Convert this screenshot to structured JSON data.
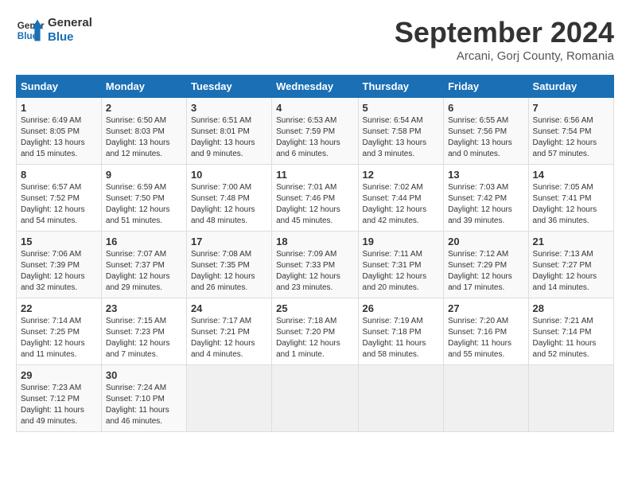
{
  "logo": {
    "line1": "General",
    "line2": "Blue"
  },
  "title": "September 2024",
  "subtitle": "Arcani, Gorj County, Romania",
  "days_of_week": [
    "Sunday",
    "Monday",
    "Tuesday",
    "Wednesday",
    "Thursday",
    "Friday",
    "Saturday"
  ],
  "weeks": [
    [
      {
        "day": 1,
        "lines": [
          "Sunrise: 6:49 AM",
          "Sunset: 8:05 PM",
          "Daylight: 13 hours",
          "and 15 minutes."
        ]
      },
      {
        "day": 2,
        "lines": [
          "Sunrise: 6:50 AM",
          "Sunset: 8:03 PM",
          "Daylight: 13 hours",
          "and 12 minutes."
        ]
      },
      {
        "day": 3,
        "lines": [
          "Sunrise: 6:51 AM",
          "Sunset: 8:01 PM",
          "Daylight: 13 hours",
          "and 9 minutes."
        ]
      },
      {
        "day": 4,
        "lines": [
          "Sunrise: 6:53 AM",
          "Sunset: 7:59 PM",
          "Daylight: 13 hours",
          "and 6 minutes."
        ]
      },
      {
        "day": 5,
        "lines": [
          "Sunrise: 6:54 AM",
          "Sunset: 7:58 PM",
          "Daylight: 13 hours",
          "and 3 minutes."
        ]
      },
      {
        "day": 6,
        "lines": [
          "Sunrise: 6:55 AM",
          "Sunset: 7:56 PM",
          "Daylight: 13 hours",
          "and 0 minutes."
        ]
      },
      {
        "day": 7,
        "lines": [
          "Sunrise: 6:56 AM",
          "Sunset: 7:54 PM",
          "Daylight: 12 hours",
          "and 57 minutes."
        ]
      }
    ],
    [
      {
        "day": 8,
        "lines": [
          "Sunrise: 6:57 AM",
          "Sunset: 7:52 PM",
          "Daylight: 12 hours",
          "and 54 minutes."
        ]
      },
      {
        "day": 9,
        "lines": [
          "Sunrise: 6:59 AM",
          "Sunset: 7:50 PM",
          "Daylight: 12 hours",
          "and 51 minutes."
        ]
      },
      {
        "day": 10,
        "lines": [
          "Sunrise: 7:00 AM",
          "Sunset: 7:48 PM",
          "Daylight: 12 hours",
          "and 48 minutes."
        ]
      },
      {
        "day": 11,
        "lines": [
          "Sunrise: 7:01 AM",
          "Sunset: 7:46 PM",
          "Daylight: 12 hours",
          "and 45 minutes."
        ]
      },
      {
        "day": 12,
        "lines": [
          "Sunrise: 7:02 AM",
          "Sunset: 7:44 PM",
          "Daylight: 12 hours",
          "and 42 minutes."
        ]
      },
      {
        "day": 13,
        "lines": [
          "Sunrise: 7:03 AM",
          "Sunset: 7:42 PM",
          "Daylight: 12 hours",
          "and 39 minutes."
        ]
      },
      {
        "day": 14,
        "lines": [
          "Sunrise: 7:05 AM",
          "Sunset: 7:41 PM",
          "Daylight: 12 hours",
          "and 36 minutes."
        ]
      }
    ],
    [
      {
        "day": 15,
        "lines": [
          "Sunrise: 7:06 AM",
          "Sunset: 7:39 PM",
          "Daylight: 12 hours",
          "and 32 minutes."
        ]
      },
      {
        "day": 16,
        "lines": [
          "Sunrise: 7:07 AM",
          "Sunset: 7:37 PM",
          "Daylight: 12 hours",
          "and 29 minutes."
        ]
      },
      {
        "day": 17,
        "lines": [
          "Sunrise: 7:08 AM",
          "Sunset: 7:35 PM",
          "Daylight: 12 hours",
          "and 26 minutes."
        ]
      },
      {
        "day": 18,
        "lines": [
          "Sunrise: 7:09 AM",
          "Sunset: 7:33 PM",
          "Daylight: 12 hours",
          "and 23 minutes."
        ]
      },
      {
        "day": 19,
        "lines": [
          "Sunrise: 7:11 AM",
          "Sunset: 7:31 PM",
          "Daylight: 12 hours",
          "and 20 minutes."
        ]
      },
      {
        "day": 20,
        "lines": [
          "Sunrise: 7:12 AM",
          "Sunset: 7:29 PM",
          "Daylight: 12 hours",
          "and 17 minutes."
        ]
      },
      {
        "day": 21,
        "lines": [
          "Sunrise: 7:13 AM",
          "Sunset: 7:27 PM",
          "Daylight: 12 hours",
          "and 14 minutes."
        ]
      }
    ],
    [
      {
        "day": 22,
        "lines": [
          "Sunrise: 7:14 AM",
          "Sunset: 7:25 PM",
          "Daylight: 12 hours",
          "and 11 minutes."
        ]
      },
      {
        "day": 23,
        "lines": [
          "Sunrise: 7:15 AM",
          "Sunset: 7:23 PM",
          "Daylight: 12 hours",
          "and 7 minutes."
        ]
      },
      {
        "day": 24,
        "lines": [
          "Sunrise: 7:17 AM",
          "Sunset: 7:21 PM",
          "Daylight: 12 hours",
          "and 4 minutes."
        ]
      },
      {
        "day": 25,
        "lines": [
          "Sunrise: 7:18 AM",
          "Sunset: 7:20 PM",
          "Daylight: 12 hours",
          "and 1 minute."
        ]
      },
      {
        "day": 26,
        "lines": [
          "Sunrise: 7:19 AM",
          "Sunset: 7:18 PM",
          "Daylight: 11 hours",
          "and 58 minutes."
        ]
      },
      {
        "day": 27,
        "lines": [
          "Sunrise: 7:20 AM",
          "Sunset: 7:16 PM",
          "Daylight: 11 hours",
          "and 55 minutes."
        ]
      },
      {
        "day": 28,
        "lines": [
          "Sunrise: 7:21 AM",
          "Sunset: 7:14 PM",
          "Daylight: 11 hours",
          "and 52 minutes."
        ]
      }
    ],
    [
      {
        "day": 29,
        "lines": [
          "Sunrise: 7:23 AM",
          "Sunset: 7:12 PM",
          "Daylight: 11 hours",
          "and 49 minutes."
        ]
      },
      {
        "day": 30,
        "lines": [
          "Sunrise: 7:24 AM",
          "Sunset: 7:10 PM",
          "Daylight: 11 hours",
          "and 46 minutes."
        ]
      },
      null,
      null,
      null,
      null,
      null
    ]
  ]
}
